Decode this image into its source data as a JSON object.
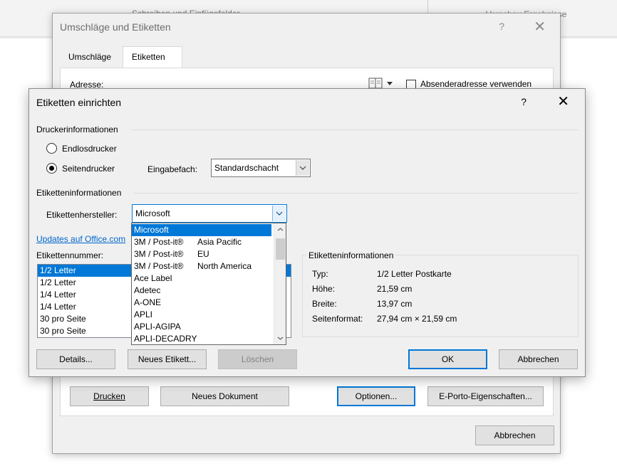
{
  "background": {
    "ribbon_left_text": "Schreiben und Einfügefelder",
    "ribbon_right_text": "Vorschau Ergebnisse"
  },
  "outer_dialog": {
    "title": "Umschläge und Etiketten",
    "help": "?",
    "close": "✕",
    "tabs": [
      {
        "label": "Umschläge",
        "active": false
      },
      {
        "label": "Etiketten",
        "active": true
      }
    ],
    "address_label": "Adresse:",
    "sender_checkbox_label": "Absenderadresse verwenden",
    "buttons": {
      "print": "Drucken",
      "new_document": "Neues Dokument",
      "options": "Optionen...",
      "eporto": "E-Porto-Eigenschaften...",
      "cancel": "Abbrechen"
    }
  },
  "inner_dialog": {
    "title": "Etiketten einrichten",
    "help": "?",
    "close": "✕",
    "printer_section": "Druckerinformationen",
    "radio_continuous": "Endlosdrucker",
    "radio_page": "Seitendrucker",
    "tray_label": "Eingabefach:",
    "tray_value": "Standardschacht",
    "label_section": "Etiketteninformationen",
    "vendor_label": "Etikettenhersteller:",
    "vendor_value": "Microsoft",
    "updates_link": "Updates auf Office.com",
    "number_label": "Etikettennummer:",
    "numbers": [
      {
        "text": "1/2 Letter",
        "selected": true
      },
      {
        "text": "1/2 Letter",
        "selected": false
      },
      {
        "text": "1/4 Letter",
        "selected": false
      },
      {
        "text": "1/4 Letter",
        "selected": false
      },
      {
        "text": "30 pro Seite",
        "selected": false
      },
      {
        "text": "30 pro Seite",
        "selected": false
      }
    ],
    "info_group": "Etiketteninformationen",
    "info": [
      {
        "key": "Typ:",
        "value": "1/2 Letter Postkarte"
      },
      {
        "key": "Höhe:",
        "value": "21,59 cm"
      },
      {
        "key": "Breite:",
        "value": "13,97 cm"
      },
      {
        "key": "Seitenformat:",
        "value": "27,94 cm × 21,59 cm"
      }
    ],
    "buttons": {
      "details": "Details...",
      "new_label": "Neues Etikett...",
      "delete": "Löschen",
      "ok": "OK",
      "cancel": "Abbrechen"
    }
  },
  "vendor_dropdown": {
    "items": [
      {
        "text": "Microsoft",
        "sub": "",
        "selected": true
      },
      {
        "text": "3M / Post-it®",
        "sub": "Asia Pacific",
        "selected": false
      },
      {
        "text": "3M / Post-it®",
        "sub": "EU",
        "selected": false
      },
      {
        "text": "3M / Post-it®",
        "sub": "North America",
        "selected": false
      },
      {
        "text": "Ace Label",
        "sub": "",
        "selected": false
      },
      {
        "text": "Adetec",
        "sub": "",
        "selected": false
      },
      {
        "text": "A-ONE",
        "sub": "",
        "selected": false
      },
      {
        "text": "APLI",
        "sub": "",
        "selected": false
      },
      {
        "text": "APLI-AGIPA",
        "sub": "",
        "selected": false
      },
      {
        "text": "APLI-DECADRY",
        "sub": "",
        "selected": false
      }
    ]
  },
  "colors": {
    "accent": "#0078d7",
    "link": "#0066cc",
    "dialog_bg": "#f0f0f0"
  }
}
